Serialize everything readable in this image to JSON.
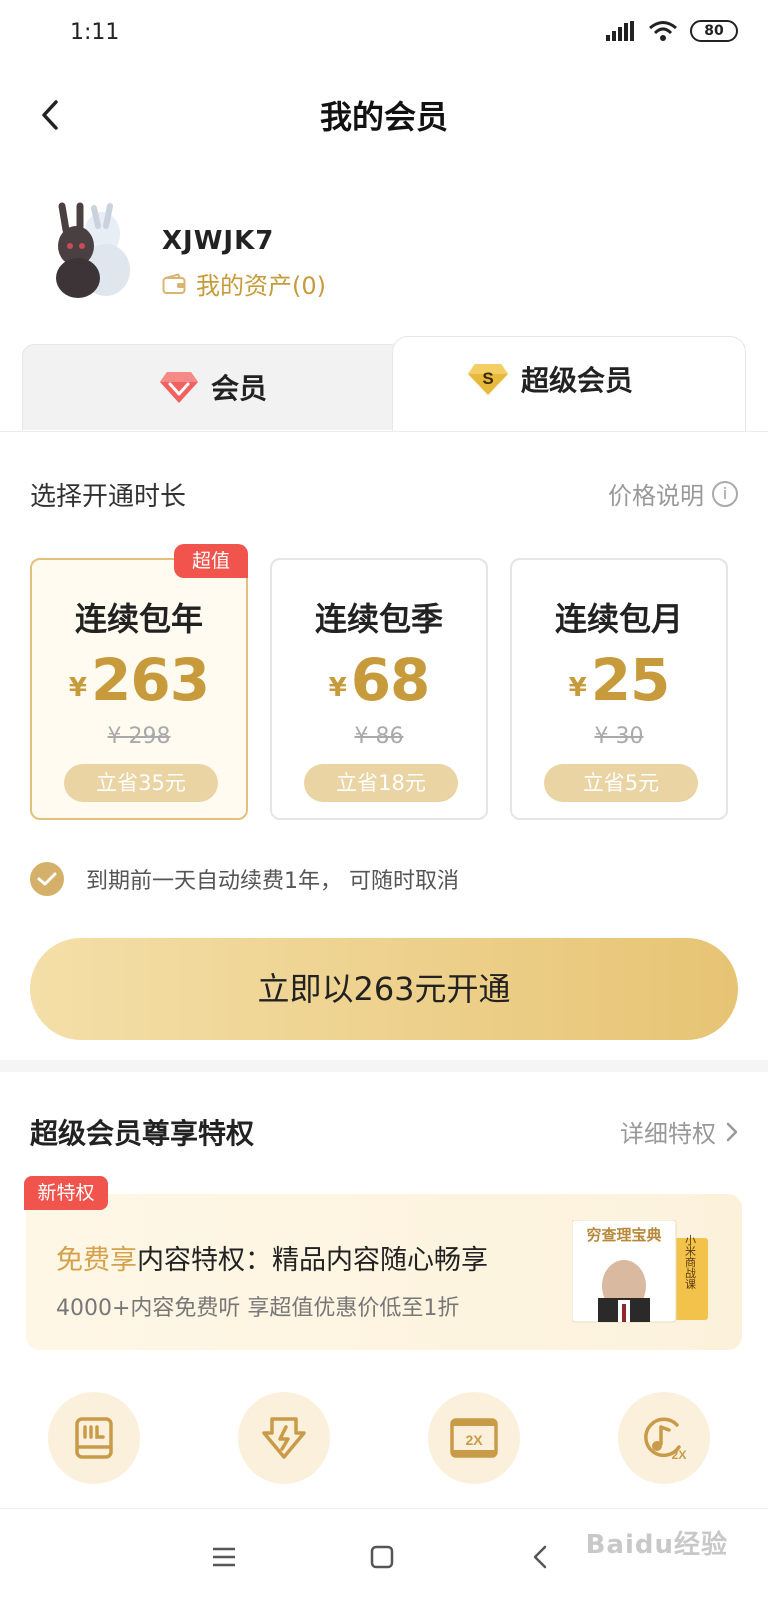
{
  "status_bar": {
    "time": "1:11",
    "battery": "80"
  },
  "header": {
    "title": "我的会员"
  },
  "user": {
    "name": "XJWJK7",
    "assets_label": "我的资产(0)"
  },
  "tabs": [
    {
      "label": "会员",
      "icon": "red-diamond-icon",
      "active": false
    },
    {
      "label": "超级会员",
      "icon": "gold-s-diamond-icon",
      "active": true
    }
  ],
  "duration": {
    "title": "选择开通时长",
    "price_help": "价格说明"
  },
  "plans": [
    {
      "name": "连续包年",
      "currency": "¥",
      "price": "263",
      "original": "¥ 298",
      "save": "立省35元",
      "badge": "超值",
      "selected": true
    },
    {
      "name": "连续包季",
      "currency": "¥",
      "price": "68",
      "original": "¥ 86",
      "save": "立省18元",
      "selected": false
    },
    {
      "name": "连续包月",
      "currency": "¥",
      "price": "25",
      "original": "¥ 30",
      "save": "立省5元",
      "selected": false
    }
  ],
  "auto_renew": {
    "text": "到期前一天自动续费1年， 可随时取消",
    "checked": true
  },
  "cta": {
    "label": "立即以263元开通"
  },
  "privileges": {
    "title": "超级会员尊享特权",
    "more_label": "详细特权",
    "feature": {
      "badge": "新特权",
      "highlight": "免费享",
      "line1_rest": "内容特权：精品内容随心畅享",
      "line2": "4000+内容免费听  享超值优惠价低至1折",
      "book_title": "穷查理宝典",
      "book_side": "小米商战课"
    },
    "icons": [
      "book-privilege-icon",
      "download-privilege-icon",
      "video-2x-icon",
      "audio-2x-icon"
    ]
  },
  "watermark": "Baidu经验",
  "colors": {
    "gold": "#c79a3b",
    "red_badge": "#f0544c",
    "cta_start": "#f4dfa8",
    "cta_end": "#e7c474"
  }
}
